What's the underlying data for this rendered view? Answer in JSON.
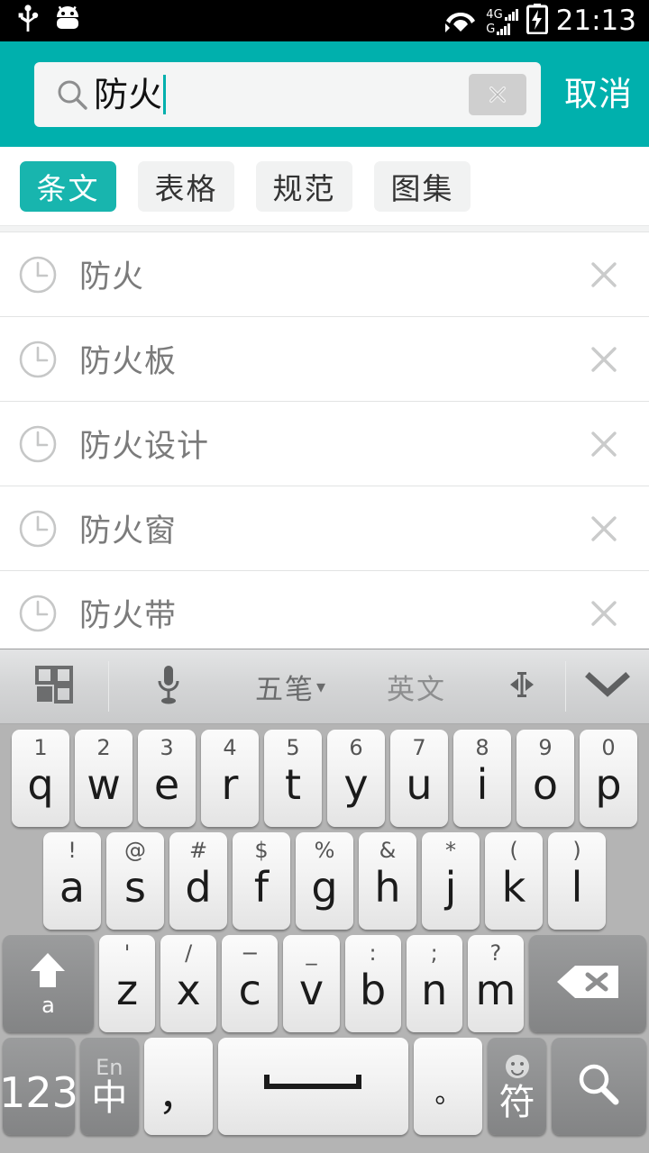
{
  "statusbar": {
    "icons": [
      "usb-icon",
      "android-robot-icon",
      "wifi-icon",
      "battery-charging-icon"
    ],
    "signal_4g_label": "4G",
    "signal_g_label": "G",
    "time": "21:13"
  },
  "search": {
    "query": "防火",
    "placeholder": "",
    "search_icon": "search-icon",
    "clear_label": "✕",
    "cancel_label": "取消",
    "accent_color": "#00b0ad",
    "field_bg": "#f4f5f5"
  },
  "tabs": [
    {
      "label": "条文",
      "active": true
    },
    {
      "label": "表格",
      "active": false
    },
    {
      "label": "规范",
      "active": false
    },
    {
      "label": "图集",
      "active": false
    }
  ],
  "history": {
    "items": [
      {
        "label": "防火"
      },
      {
        "label": "防火板"
      },
      {
        "label": "防火设计"
      },
      {
        "label": "防火窗"
      },
      {
        "label": "防火带"
      }
    ],
    "row_icon": "clock-icon",
    "delete_icon": "close-icon"
  },
  "keyboard": {
    "toolbar": {
      "grid_icon": "grid-icon",
      "mic_icon": "microphone-icon",
      "ime_label": "五笔",
      "ime_caret": "▾",
      "lang_label": "英文",
      "cursor_icon": "cursor-move-icon",
      "collapse_icon": "chevron-down-icon"
    },
    "row1": [
      {
        "sup": "1",
        "main": "q"
      },
      {
        "sup": "2",
        "main": "w"
      },
      {
        "sup": "3",
        "main": "e"
      },
      {
        "sup": "4",
        "main": "r"
      },
      {
        "sup": "5",
        "main": "t"
      },
      {
        "sup": "6",
        "main": "y"
      },
      {
        "sup": "7",
        "main": "u"
      },
      {
        "sup": "8",
        "main": "i"
      },
      {
        "sup": "9",
        "main": "o"
      },
      {
        "sup": "0",
        "main": "p"
      }
    ],
    "row2": [
      {
        "sup": "!",
        "main": "a"
      },
      {
        "sup": "@",
        "main": "s"
      },
      {
        "sup": "#",
        "main": "d"
      },
      {
        "sup": "$",
        "main": "f"
      },
      {
        "sup": "%",
        "main": "g"
      },
      {
        "sup": "&",
        "main": "h"
      },
      {
        "sup": "*",
        "main": "j"
      },
      {
        "sup": "(",
        "main": "k"
      },
      {
        "sup": ")",
        "main": "l"
      }
    ],
    "row3": [
      {
        "sup": "'",
        "main": "z"
      },
      {
        "sup": "/",
        "main": "x"
      },
      {
        "sup": "−",
        "main": "c"
      },
      {
        "sup": "_",
        "main": "v"
      },
      {
        "sup": ":",
        "main": "b"
      },
      {
        "sup": ";",
        "main": "n"
      },
      {
        "sup": "?",
        "main": "m"
      }
    ],
    "shift_key": {
      "icon": "shift-arrow-icon",
      "label": "a"
    },
    "backspace_key": {
      "icon": "backspace-icon"
    },
    "row4": {
      "num_label": "123",
      "lang_en": "En",
      "lang_cn": "中",
      "comma": "，",
      "space_icon": "space-bar-icon",
      "period": "。",
      "symbol_label": "符",
      "emoji_icon": "smiley-icon",
      "search_icon": "search-icon"
    }
  }
}
